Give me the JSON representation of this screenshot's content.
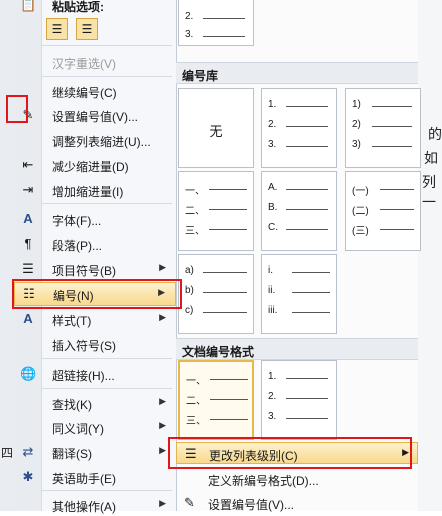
{
  "menu": {
    "paste_options_label": "粘贴选项:",
    "items": [
      {
        "label": "汉字重选(V)",
        "icon": "chinese-reselect-icon",
        "disabled": true
      },
      {
        "label": "继续编号(C)",
        "icon": "",
        "disabled": false
      },
      {
        "label": "设置编号值(V)...",
        "icon": "pencil-icon",
        "disabled": false
      },
      {
        "label": "调整列表缩进(U)...",
        "icon": "",
        "disabled": false
      },
      {
        "label": "减少缩进量(D)",
        "icon": "decrease-indent-icon",
        "disabled": false
      },
      {
        "label": "增加缩进量(I)",
        "icon": "increase-indent-icon",
        "disabled": false
      },
      {
        "label": "字体(F)...",
        "icon": "font-icon",
        "disabled": false
      },
      {
        "label": "段落(P)...",
        "icon": "paragraph-icon",
        "disabled": false
      },
      {
        "label": "项目符号(B)",
        "icon": "bullets-icon",
        "disabled": false,
        "submenu": true
      },
      {
        "label": "编号(N)",
        "icon": "numbering-icon",
        "disabled": false,
        "submenu": true,
        "highlighted": true
      },
      {
        "label": "样式(T)",
        "icon": "styles-icon",
        "disabled": false,
        "submenu": true
      },
      {
        "label": "插入符号(S)",
        "icon": "",
        "disabled": false
      },
      {
        "label": "超链接(H)...",
        "icon": "hyperlink-icon",
        "disabled": false
      },
      {
        "label": "查找(K)",
        "icon": "",
        "disabled": false,
        "submenu": true
      },
      {
        "label": "同义词(Y)",
        "icon": "",
        "disabled": false,
        "submenu": true
      },
      {
        "label": "翻译(S)",
        "icon": "translate-icon",
        "disabled": false,
        "submenu": true
      },
      {
        "label": "英语助手(E)",
        "icon": "english-assistant-icon",
        "disabled": false
      },
      {
        "label": "其他操作(A)",
        "icon": "",
        "disabled": false,
        "submenu": true
      }
    ]
  },
  "gallery": {
    "top_rows": [
      "2.",
      "3."
    ],
    "library_title": "编号库",
    "none_label": "无",
    "library": [
      [
        "1.",
        "2.",
        "3."
      ],
      [
        "1)",
        "2)",
        "3)"
      ],
      [
        "一、",
        "二、",
        "三、"
      ],
      [
        "A.",
        "B.",
        "C."
      ],
      [
        "(一)",
        "(二)",
        "(三)"
      ],
      [
        "a)",
        "b)",
        "c)"
      ],
      [
        "i.",
        "ii.",
        "iii."
      ]
    ],
    "doc_title": "文档编号格式",
    "doc_formats": [
      [
        "一、",
        "二、",
        "三、"
      ],
      [
        "1.",
        "2.",
        "3."
      ]
    ],
    "change_level_label": "更改列表级别(C)",
    "define_new_label": "定义新编号格式(D)...",
    "set_value_label": "设置编号值(V)..."
  },
  "background": {
    "right_chars": [
      "的",
      "如",
      "列一"
    ],
    "left_chars": [
      "四"
    ]
  },
  "colors": {
    "highlight": "#f8d98c",
    "annotation_red": "#e0161b"
  }
}
